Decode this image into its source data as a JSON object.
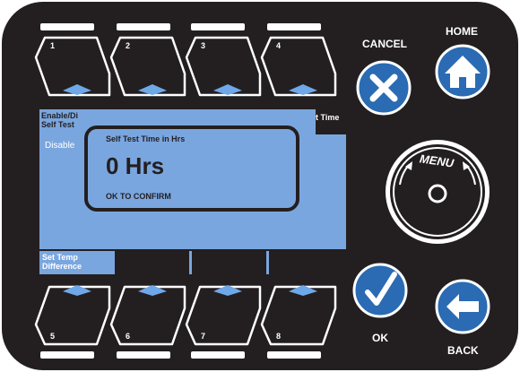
{
  "soft_keys_top": [
    "1",
    "2",
    "3",
    "4"
  ],
  "soft_keys_bottom": [
    "5",
    "6",
    "7",
    "8"
  ],
  "buttons": {
    "cancel": "CANCEL",
    "home": "HOME",
    "ok": "OK",
    "back": "BACK",
    "menu": "MENU"
  },
  "screen": {
    "top_left_label": "Enable/Di\nSelf Test",
    "top_right_label": "t Time",
    "left_value": "Disable",
    "bottom_softkey_labels": [
      "Set Temp\nDifference",
      "",
      "",
      ""
    ],
    "dialog": {
      "title": "Self Test Time in Hrs",
      "value": "0 Hrs",
      "hint": "OK TO CONFIRM"
    }
  },
  "colors": {
    "bezel": "#231f20",
    "screen": "#7aa6df",
    "button_blue": "#2a6bb3",
    "indicator_white": "#ffffff",
    "key_arrow_blue": "#6fa8e8"
  },
  "icons": {
    "cancel": "x-icon",
    "home": "house-icon",
    "ok": "checkmark-icon",
    "back": "arrow-left-icon",
    "menu": "ring-icon"
  }
}
